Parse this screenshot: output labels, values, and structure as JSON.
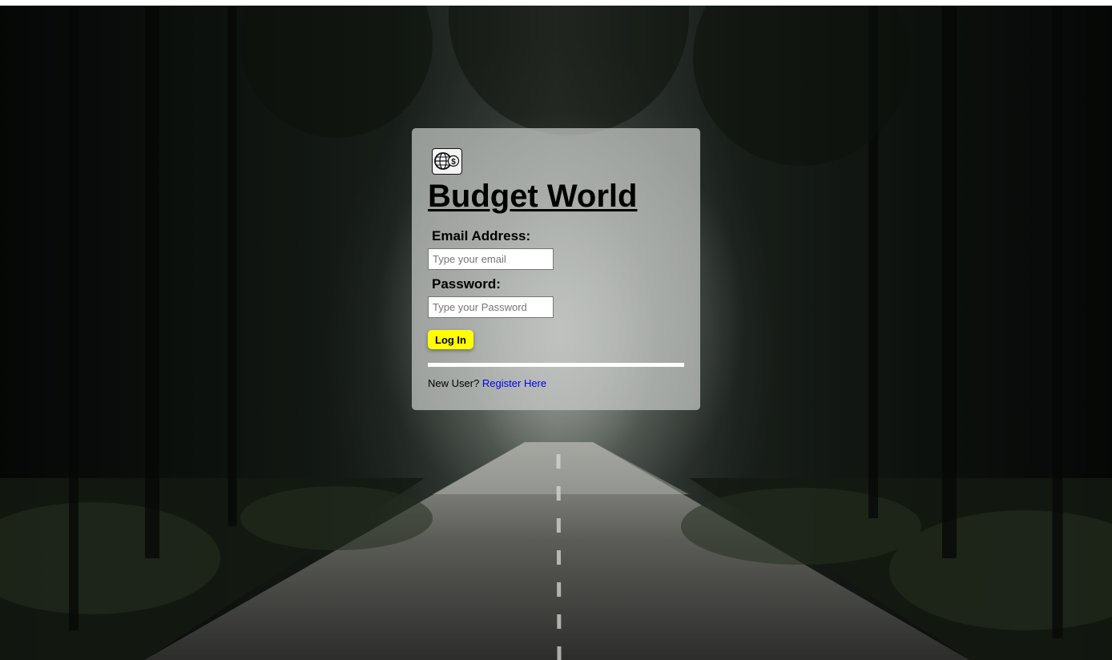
{
  "brand": {
    "title": "Budget World",
    "logo_icon": "globe-dollar-icon"
  },
  "login_form": {
    "email_label": "Email Address:",
    "email_placeholder": "Type your email",
    "password_label": "Password:",
    "password_placeholder": "Type your Password",
    "submit_label": "Log In"
  },
  "register": {
    "prompt": "New User?",
    "link_text": "Register Here"
  },
  "colors": {
    "button_background": "#ffff00",
    "link": "#0000ee",
    "card_background": "rgba(200, 203, 200, 0.72)"
  },
  "background_image": "dark-forest-road"
}
